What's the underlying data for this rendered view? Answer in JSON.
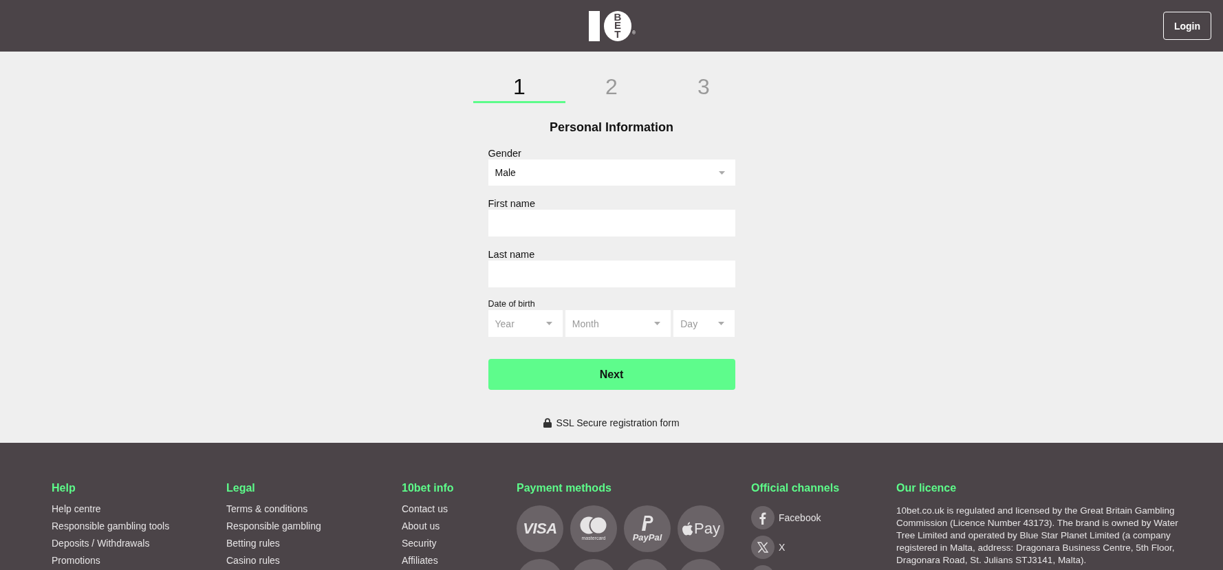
{
  "header": {
    "logo": {
      "letters": "BET",
      "mark": "®"
    },
    "login_button": "Login"
  },
  "steps": [
    {
      "label": "1",
      "selected": true
    },
    {
      "label": "2",
      "selected": false
    },
    {
      "label": "3",
      "selected": false
    }
  ],
  "form": {
    "title": "Personal Information",
    "fields": [
      {
        "kind": "select",
        "label": "Gender",
        "value": "Male"
      },
      {
        "kind": "text",
        "label": "First name"
      },
      {
        "kind": "text",
        "label": "Last name"
      },
      {
        "kind": "date",
        "label": "Date of birth",
        "parts": [
          {
            "placeholder": "Year"
          },
          {
            "placeholder": "Month"
          },
          {
            "placeholder": "Day"
          }
        ]
      }
    ],
    "submit_button": "Next",
    "security_note": "SSL Secure registration form"
  },
  "footer": {
    "columns": [
      {
        "kind": "links",
        "title": "Help",
        "links": [
          "Help centre",
          "Responsible gambling tools",
          "Deposits / Withdrawals",
          "Promotions"
        ]
      },
      {
        "kind": "links",
        "title": "Legal",
        "links": [
          "Terms & conditions",
          "Responsible gambling",
          "Betting rules",
          "Casino rules"
        ]
      },
      {
        "kind": "links",
        "title": "10bet info",
        "links": [
          "Contact us",
          "About us",
          "Security",
          "Affiliates"
        ]
      },
      {
        "kind": "payments",
        "title": "Payment methods",
        "methods": [
          {
            "kind": "visa",
            "text": "VISA"
          },
          {
            "kind": "mastercard",
            "text": "mastercard"
          },
          {
            "kind": "paypal",
            "text": "PayPal"
          },
          {
            "kind": "applepay",
            "text": "Pay"
          },
          {
            "kind": "blank"
          },
          {
            "kind": "blank"
          },
          {
            "kind": "blank"
          },
          {
            "kind": "blank"
          }
        ]
      },
      {
        "kind": "channels",
        "title": "Official channels",
        "channels": [
          {
            "kind": "facebook",
            "label": "Facebook"
          },
          {
            "kind": "x",
            "label": "X"
          },
          {
            "kind": "blank"
          }
        ]
      },
      {
        "kind": "text",
        "title": "Our licence",
        "text": "10bet.co.uk is regulated and licensed by the Great Britain Gambling Commission (Licence Number 43173). The brand is owned by Water Tree Limited and operated by Blue Star Planet Limited (a company registered in Malta, address: Dragonara Business Centre, 5th Floor, Dragonara Road, St. Julians STJ3141, Malta)."
      }
    ]
  }
}
